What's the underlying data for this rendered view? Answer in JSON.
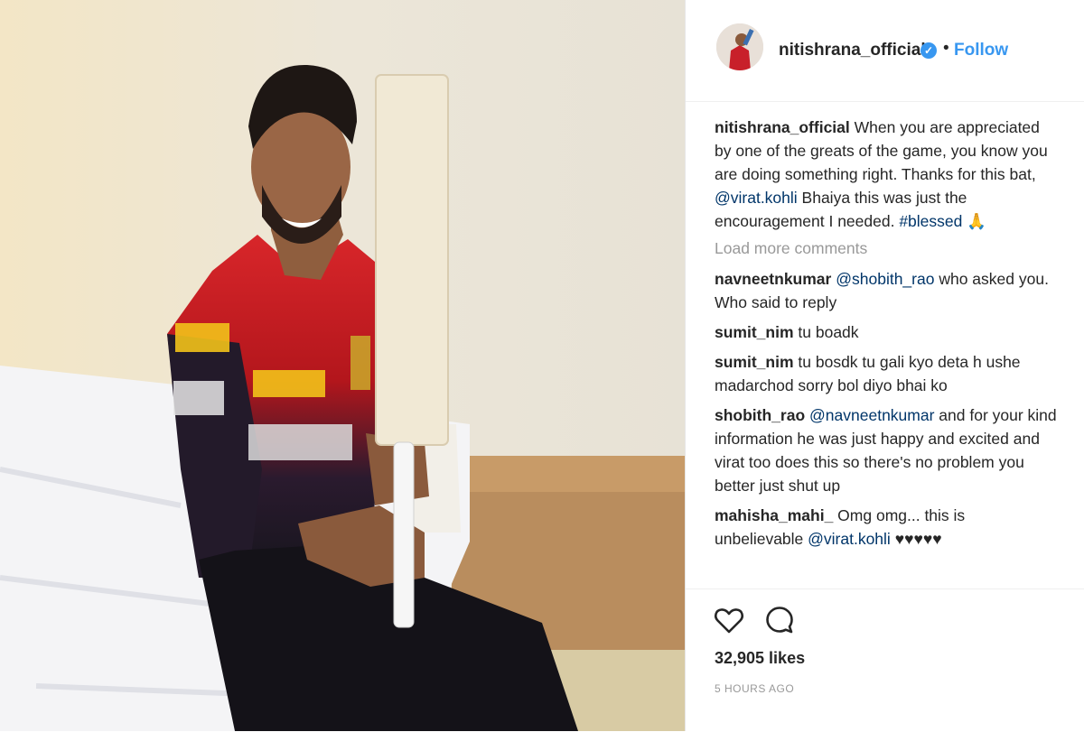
{
  "post": {
    "author": "nitishrana_official",
    "follow_label": "Follow",
    "dot": "•",
    "verified_icon": "verified-badge-icon"
  },
  "caption": {
    "user": "nitishrana_official",
    "text_1": " When you are appreciated by one of the greats of the game, you know you are doing something right. Thanks for this bat, ",
    "mention": "@virat.kohli",
    "text_2": " Bhaiya this was just the encouragement I needed. ",
    "hashtag": "#blessed",
    "emoji": "🙏"
  },
  "load_more": "Load more comments",
  "comments": [
    {
      "user": "navneetnkumar",
      "mention": "@shobith_rao",
      "text": " who asked you. Who said to reply"
    },
    {
      "user": "sumit_nim",
      "mention": "",
      "text": " tu boadk"
    },
    {
      "user": "sumit_nim",
      "mention": "",
      "text": " tu bosdk tu gali kyo deta h ushe madarchod sorry bol diyo bhai ko"
    },
    {
      "user": "shobith_rao",
      "mention": "@navneetnkumar",
      "text": " and for your kind information he was just happy and excited and virat too does this so there's no problem you better just shut up"
    },
    {
      "user": "mahisha_mahi_",
      "text": " Omg omg... this is unbelievable ",
      "mention_after": "@virat.kohli",
      "suffix": " ♥♥♥♥♥"
    }
  ],
  "likes": "32,905 likes",
  "time": "5 HOURS AGO",
  "icons": {
    "like": "heart-icon",
    "comment": "comment-icon"
  }
}
